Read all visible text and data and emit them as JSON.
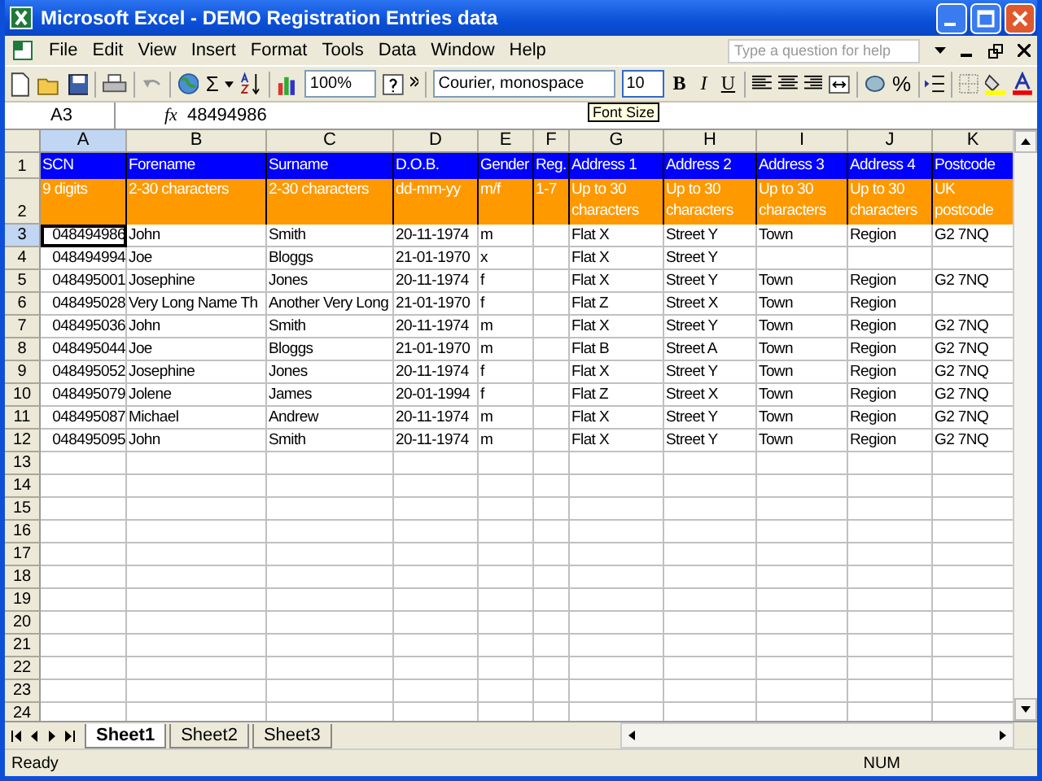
{
  "window": {
    "title": "Microsoft Excel - DEMO Registration Entries data"
  },
  "menu": [
    "File",
    "Edit",
    "View",
    "Insert",
    "Format",
    "Tools",
    "Data",
    "Window",
    "Help"
  ],
  "help_box": {
    "placeholder": "Type a question for help"
  },
  "toolbar": {
    "autosum": "Σ",
    "zoom": "100%",
    "font": "Courier, monospace",
    "font_size": "10",
    "format_buttons": [
      "B",
      "I",
      "U"
    ],
    "percent": "%",
    "tooltip": "Font Size"
  },
  "formula_bar": {
    "name_box": "A3",
    "fx": "fx",
    "value": "48494986"
  },
  "columns": [
    {
      "letter": "A",
      "selected": true,
      "kind": "number"
    },
    {
      "letter": "B",
      "selected": false,
      "kind": "text"
    },
    {
      "letter": "C",
      "selected": false,
      "kind": "text"
    },
    {
      "letter": "D",
      "selected": false,
      "kind": "text"
    },
    {
      "letter": "E",
      "selected": false,
      "kind": "text"
    },
    {
      "letter": "F",
      "selected": false,
      "kind": "text"
    },
    {
      "letter": "G",
      "selected": false,
      "kind": "text"
    },
    {
      "letter": "H",
      "selected": false,
      "kind": "text"
    },
    {
      "letter": "I",
      "selected": false,
      "kind": "text"
    },
    {
      "letter": "J",
      "selected": false,
      "kind": "text"
    },
    {
      "letter": "K",
      "selected": false,
      "kind": "text"
    }
  ],
  "rows": [
    {
      "number": "1",
      "kind": "header",
      "selected": false,
      "cells": [
        "SCN",
        "Forename",
        "Surname",
        "D.O.B.",
        "Gender",
        "Reg.",
        "Address 1",
        "Address 2",
        "Address 3",
        "Address 4",
        "Postcode"
      ]
    },
    {
      "number": "2",
      "kind": "hint",
      "selected": false,
      "cells": [
        "9 digits",
        "2-30 characters",
        "2-30 characters",
        "dd-mm-yy",
        "m/f",
        "1-7",
        "Up to 30 characters",
        "Up to 30 characters",
        "Up to 30 characters",
        "Up to 30 characters",
        "UK postcode"
      ]
    },
    {
      "number": "3",
      "kind": "data",
      "selected": true,
      "cells": [
        "048494986",
        "John",
        "Smith",
        "20-11-1974",
        "m",
        null,
        "Flat X",
        "Street Y",
        "Town",
        "Region",
        "G2 7NQ"
      ]
    },
    {
      "number": "4",
      "kind": "data",
      "selected": false,
      "cells": [
        "048494994",
        "Joe",
        "Bloggs",
        "21-01-1970",
        "x",
        null,
        "Flat X",
        "Street Y",
        null,
        null,
        null
      ]
    },
    {
      "number": "5",
      "kind": "data",
      "selected": false,
      "cells": [
        "048495001",
        "Josephine",
        "Jones",
        "20-11-1974",
        "f",
        null,
        "Flat X",
        "Street Y",
        "Town",
        "Region",
        "G2 7NQ"
      ]
    },
    {
      "number": "6",
      "kind": "data",
      "selected": false,
      "cells": [
        "048495028",
        "Very Long Name Th",
        "Another Very Long",
        "21-01-1970",
        "f",
        null,
        "Flat Z",
        "Street X",
        "Town",
        "Region",
        null
      ]
    },
    {
      "number": "7",
      "kind": "data",
      "selected": false,
      "cells": [
        "048495036",
        "John",
        "Smith",
        "20-11-1974",
        "m",
        null,
        "Flat X",
        "Street Y",
        "Town",
        "Region",
        "G2 7NQ"
      ]
    },
    {
      "number": "8",
      "kind": "data",
      "selected": false,
      "cells": [
        "048495044",
        "Joe",
        "Bloggs",
        "21-01-1970",
        "m",
        null,
        "Flat B",
        "Street A",
        "Town",
        "Region",
        "G2 7NQ"
      ]
    },
    {
      "number": "9",
      "kind": "data",
      "selected": false,
      "cells": [
        "048495052",
        "Josephine",
        "Jones",
        "20-11-1974",
        "f",
        null,
        "Flat X",
        "Street Y",
        "Town",
        "Region",
        "G2 7NQ"
      ]
    },
    {
      "number": "10",
      "kind": "data",
      "selected": false,
      "cells": [
        "048495079",
        "Jolene",
        "James",
        "20-01-1994",
        "f",
        null,
        "Flat Z",
        "Street X",
        "Town",
        "Region",
        "G2 7NQ"
      ]
    },
    {
      "number": "11",
      "kind": "data",
      "selected": false,
      "cells": [
        "048495087",
        "Michael",
        "Andrew",
        "20-11-1974",
        "m",
        null,
        "Flat X",
        "Street Y",
        "Town",
        "Region",
        "G2 7NQ"
      ]
    },
    {
      "number": "12",
      "kind": "data",
      "selected": false,
      "cells": [
        "048495095",
        "John",
        "Smith",
        "20-11-1974",
        "m",
        null,
        "Flat X",
        "Street Y",
        "Town",
        "Region",
        "G2 7NQ"
      ]
    },
    {
      "number": "13",
      "kind": "data",
      "selected": false
    },
    {
      "number": "14",
      "kind": "data",
      "selected": false
    },
    {
      "number": "15",
      "kind": "data",
      "selected": false
    },
    {
      "number": "16",
      "kind": "data",
      "selected": false
    },
    {
      "number": "17",
      "kind": "data",
      "selected": false
    },
    {
      "number": "18",
      "kind": "data",
      "selected": false
    },
    {
      "number": "19",
      "kind": "data",
      "selected": false
    },
    {
      "number": "20",
      "kind": "data",
      "selected": false
    },
    {
      "number": "21",
      "kind": "data",
      "selected": false
    },
    {
      "number": "22",
      "kind": "data",
      "selected": false
    },
    {
      "number": "23",
      "kind": "data",
      "selected": false
    },
    {
      "number": "24",
      "kind": "data",
      "selected": false
    }
  ],
  "sheet_tabs": [
    {
      "label": "Sheet1",
      "selected": true
    },
    {
      "label": "Sheet2",
      "selected": false
    },
    {
      "label": "Sheet3",
      "selected": false
    }
  ],
  "status_bar": {
    "status": "Ready",
    "num": "NUM"
  }
}
